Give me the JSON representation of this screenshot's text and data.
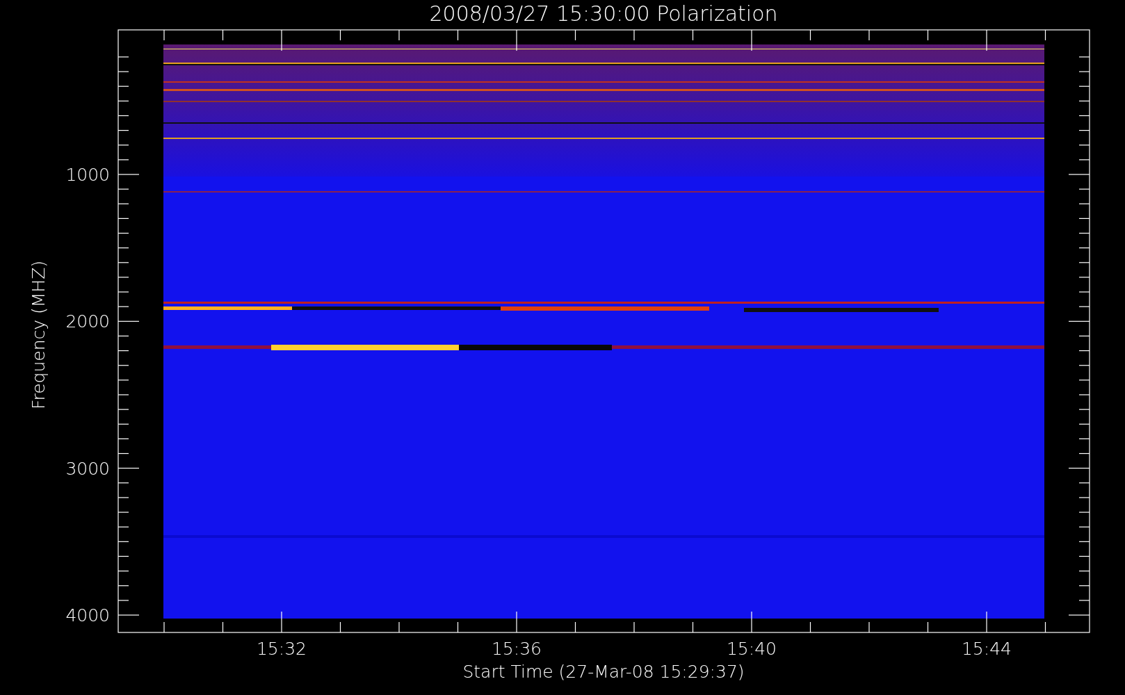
{
  "plot": {
    "title": "2008/03/27 15:30:00 Polarization",
    "y_axis": {
      "label": "Frequency (MHZ)",
      "ticks": [
        "1000",
        "2000",
        "3000",
        "4000"
      ]
    },
    "x_axis": {
      "label": "Start Time (27-Mar-08 15:29:37)",
      "ticks": [
        "15:32",
        "15:36",
        "15:40",
        "15:44"
      ]
    }
  }
}
